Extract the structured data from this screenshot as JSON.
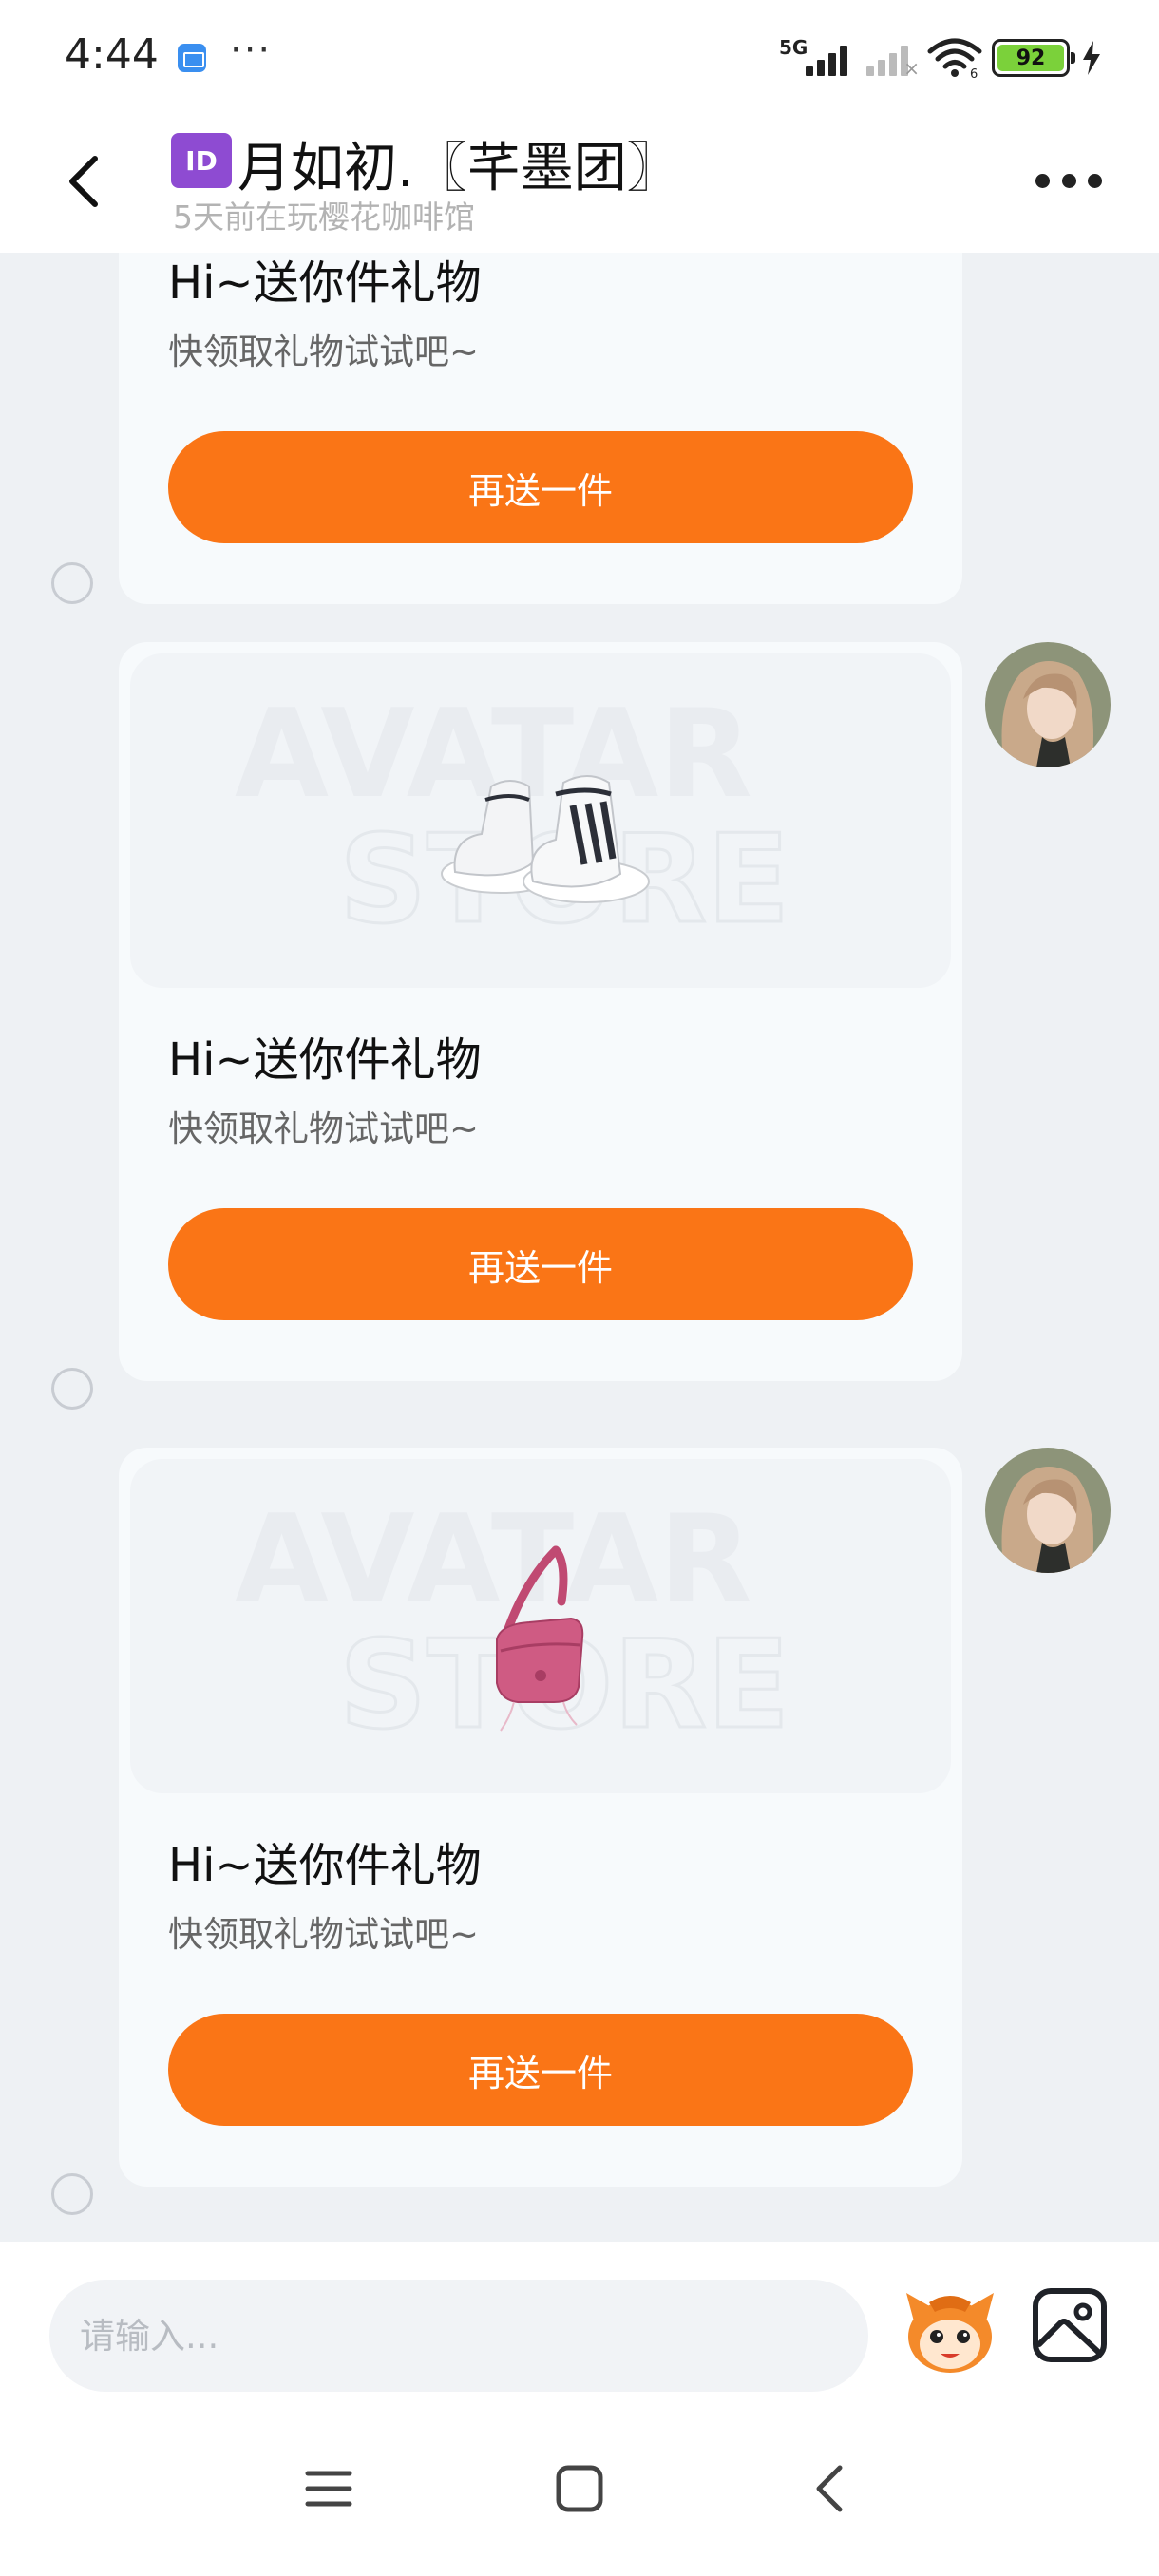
{
  "status_bar": {
    "time": "4:44",
    "more": "···",
    "network": "5G",
    "battery": "92",
    "battery_color": "#7bd13a"
  },
  "header": {
    "id_badge": "ID",
    "title": "月如初.〖芊墨团〗",
    "subtitle": "5天前在玩樱花咖啡馆",
    "icons": [
      "back-arrow-icon",
      "more-dots-icon"
    ]
  },
  "messages": [
    {
      "item": "none",
      "title": "Hi~送你件礼物",
      "subtitle": "快领取礼物试试吧~",
      "button": "再送一件"
    },
    {
      "item": "sneakers",
      "title": "Hi~送你件礼物",
      "subtitle": "快领取礼物试试吧~",
      "button": "再送一件"
    },
    {
      "item": "pink-shoulder-bag",
      "title": "Hi~送你件礼物",
      "subtitle": "快领取礼物试试吧~",
      "button": "再送一件"
    }
  ],
  "gift_image_watermark": [
    "AVATAR",
    "STORE"
  ],
  "input_bar": {
    "placeholder": "请输入...",
    "icons": [
      "mascot-emoji-icon",
      "image-picker-icon"
    ]
  },
  "nav_bar": {
    "icons": [
      "menu-lines-icon",
      "home-square-icon",
      "back-chevron-icon"
    ]
  },
  "colors": {
    "accent": "#fa7516",
    "background": "#eef1f4",
    "card": "#f7fafc"
  }
}
